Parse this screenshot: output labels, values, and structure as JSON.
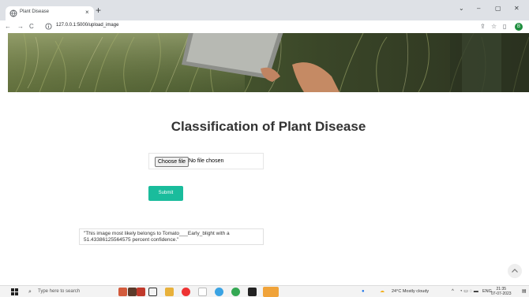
{
  "browser": {
    "tab_title": "Plant Disease",
    "tab_close": "×",
    "new_tab": "+",
    "url": "127.0.0.1:5000/upload_image",
    "profile_initial": "B",
    "window_controls": {
      "minimize": "–",
      "restore": "▢",
      "close": "✕",
      "dropdown": "⌄"
    }
  },
  "page": {
    "title": "Classification of Plant Disease",
    "file_button": "Choose file",
    "file_status": "No file chosen",
    "submit_label": "Submit",
    "result_text": "\"This image most likely belongs to Tomato___Early_blight with a 51.43386125564575 percent confidence.\"",
    "scroll_top": "^"
  },
  "taskbar": {
    "search_placeholder": "Type here to search",
    "weather": "24°C  Mostly cloudy",
    "language": "ENG",
    "time": "21:35",
    "date": "07-07-2023"
  },
  "colors": {
    "accent": "#1abc9c",
    "hero_dark": "#3d4a2c",
    "profile": "#1e8e3e"
  }
}
